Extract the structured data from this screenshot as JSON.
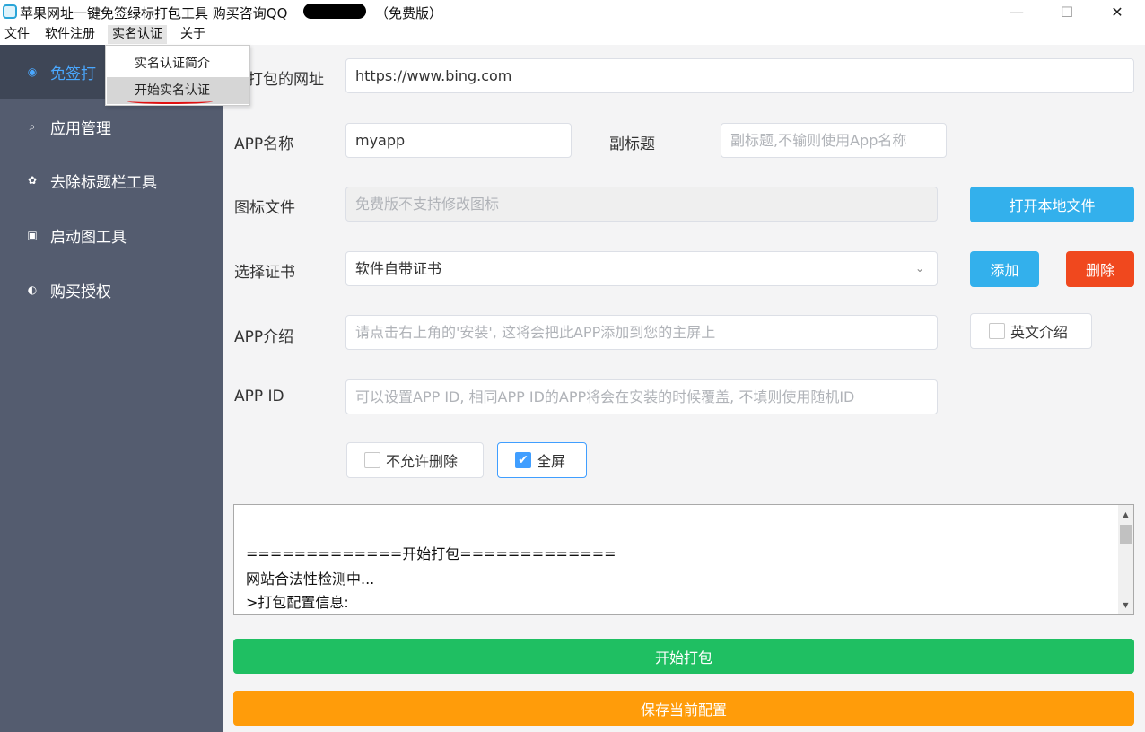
{
  "window": {
    "title": "苹果网址一键免签绿标打包工具 购买咨询QQ",
    "title_suffix": "（免费版）",
    "minimize": "—",
    "maximize": "☐",
    "close": "✕"
  },
  "menubar": {
    "items": [
      "文件",
      "软件注册",
      "实名认证",
      "关于"
    ],
    "active": "实名认证"
  },
  "dropdown": {
    "items": [
      "实名认证简介",
      "开始实名认证"
    ],
    "highlighted": "开始实名认证"
  },
  "sidebar": {
    "items": [
      {
        "label": "免签打包",
        "icon": "dashboard-icon",
        "glyph": "◉"
      },
      {
        "label": "应用管理",
        "icon": "search-icon",
        "glyph": "⌕"
      },
      {
        "label": "去除标题栏工具",
        "icon": "gear-icon",
        "glyph": "✿"
      },
      {
        "label": "启动图工具",
        "icon": "image-icon",
        "glyph": "▣"
      },
      {
        "label": "购买授权",
        "icon": "info-icon",
        "glyph": "◐"
      }
    ],
    "active_label": "免签打"
  },
  "form": {
    "url_label": "打包的网址",
    "url_value": "https://www.bing.com",
    "app_name_label": "APP名称",
    "app_name_value": "myapp",
    "subtitle_label": "副标题",
    "subtitle_placeholder": "副标题,不输则使用App名称",
    "icon_label": "图标文件",
    "icon_placeholder": "免费版不支持修改图标",
    "open_file_button": "打开本地文件",
    "cert_label": "选择证书",
    "cert_value": "软件自带证书",
    "add_button": "添加",
    "delete_button": "删除",
    "intro_label": "APP介绍",
    "intro_placeholder": "请点击右上角的'安装', 这将会把此APP添加到您的主屏上",
    "english_intro_label": "英文介绍",
    "english_intro_checked": false,
    "app_id_label": "APP ID",
    "app_id_placeholder": "可以设置APP ID, 相同APP ID的APP将会在安装的时候覆盖, 不填则使用随机ID",
    "no_delete_label": "不允许删除",
    "no_delete_checked": false,
    "fullscreen_label": "全屏",
    "fullscreen_checked": true
  },
  "log": {
    "lines": [
      "=============开始打包=============",
      "网站合法性检测中...",
      ">打包配置信息:"
    ]
  },
  "actions": {
    "start_button": "开始打包",
    "save_button": "保存当前配置"
  },
  "colors": {
    "sidebar_bg": "#545c6f",
    "accent_blue": "#33b0ec",
    "danger": "#f0481e",
    "start_green": "#1fbf62",
    "save_orange": "#ff9c0a",
    "checkbox_blue": "#409eff"
  }
}
